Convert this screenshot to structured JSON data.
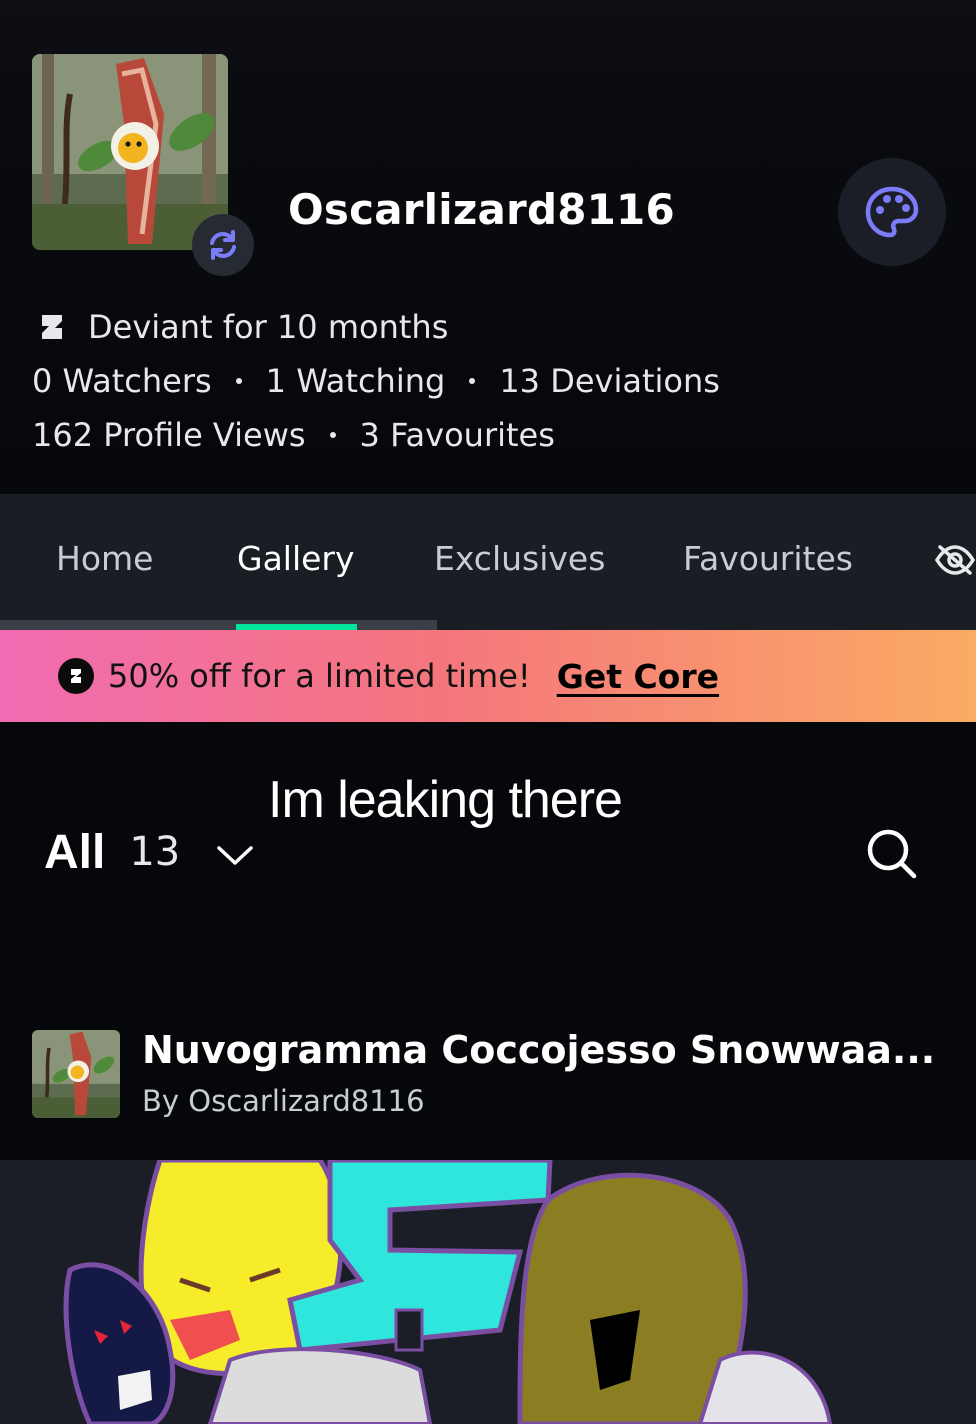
{
  "profile": {
    "username": "Oscarlizard8116",
    "deviant_since": "Deviant for 10 months",
    "watchers": "0 Watchers",
    "watching": "1 Watching",
    "deviations": "13 Deviations",
    "profile_views": "162 Profile Views",
    "favourites": "3 Favourites"
  },
  "tabs": [
    {
      "label": "Home"
    },
    {
      "label": "Gallery",
      "active": true
    },
    {
      "label": "Exclusives"
    },
    {
      "label": "Favourites"
    }
  ],
  "promo": {
    "text": "50% off for a limited time!",
    "link": "Get Core",
    "gradient": [
      "#f06bb2",
      "#f4767c",
      "#fbab64"
    ]
  },
  "caption_overlay": "Im leaking there",
  "gallery_filter": {
    "label": "All",
    "count": "13"
  },
  "deviation": {
    "title": "Nuvogramma Coccojesso Snowwaa...",
    "author": "By Oscarlizard8116"
  },
  "colors": {
    "accent_green": "#00e59b",
    "icon_purple": "#7b7cf7",
    "background": "#06070a"
  },
  "icons": [
    "refresh-icon",
    "palette-icon",
    "deviant-logo-icon",
    "eye-off-icon",
    "core-logo-icon",
    "chevron-down-icon",
    "search-icon"
  ]
}
